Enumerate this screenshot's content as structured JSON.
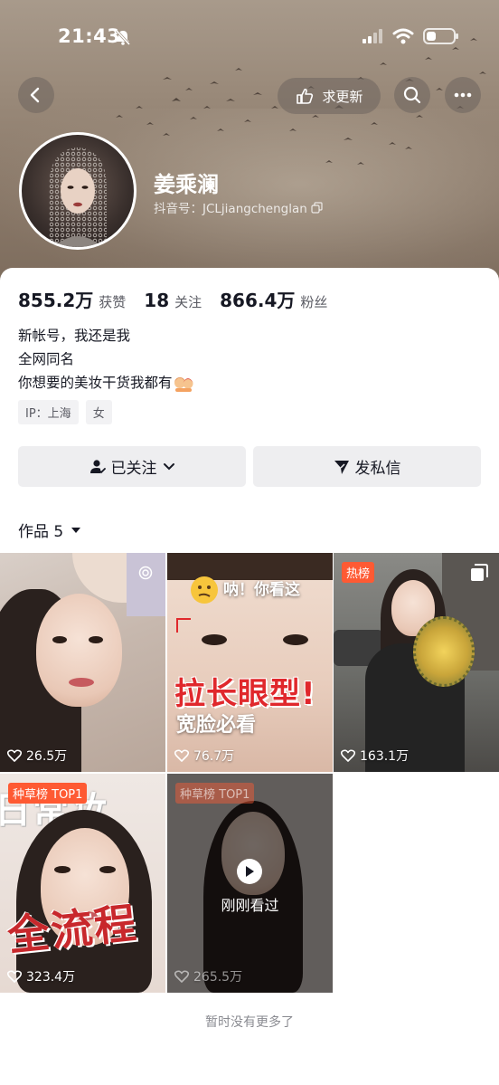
{
  "status_bar": {
    "time": "21:43"
  },
  "header": {
    "update_label": "求更新",
    "name": "姜乘澜",
    "douyin_id": "抖音号：JCLjiangchenglan"
  },
  "stats": [
    {
      "value": "855.2万",
      "label": "获赞"
    },
    {
      "value": "18",
      "label": "关注"
    },
    {
      "value": "866.4万",
      "label": "粉丝"
    }
  ],
  "bio": [
    "新帐号，我还是我",
    "全网同名",
    "你想要的美妆干货我都有"
  ],
  "tags": [
    "IP：上海",
    "女"
  ],
  "buttons": {
    "follow": "已关注",
    "message": "发私信"
  },
  "works_tab": {
    "label": "作品 5"
  },
  "videos": [
    {
      "likes": "26.5万"
    },
    {
      "likes": "76.7万",
      "overlay_top": "呐！你看这",
      "title": "拉长眼型!",
      "subtitle": "宽脸必看"
    },
    {
      "likes": "163.1万",
      "badge": "热榜"
    },
    {
      "likes": "323.4万",
      "badge": "种草榜 TOP1",
      "title_top": "日常妆",
      "title": "全流程"
    },
    {
      "likes": "265.5万",
      "badge": "种草榜 TOP1",
      "recent": "刚刚看过"
    }
  ],
  "footer": "暂时没有更多了",
  "colors": {
    "badge": "#fe5a33",
    "title_red": "#e0282c",
    "button_bg": "#eeeef0"
  },
  "icons": [
    "back-icon",
    "hand-icon",
    "search-icon",
    "more-icon",
    "copy-icon",
    "user-check-icon",
    "chevron-down-icon",
    "send-icon",
    "caret-down-icon",
    "heart-icon",
    "play-icon",
    "gallery-icon",
    "live-icon"
  ]
}
